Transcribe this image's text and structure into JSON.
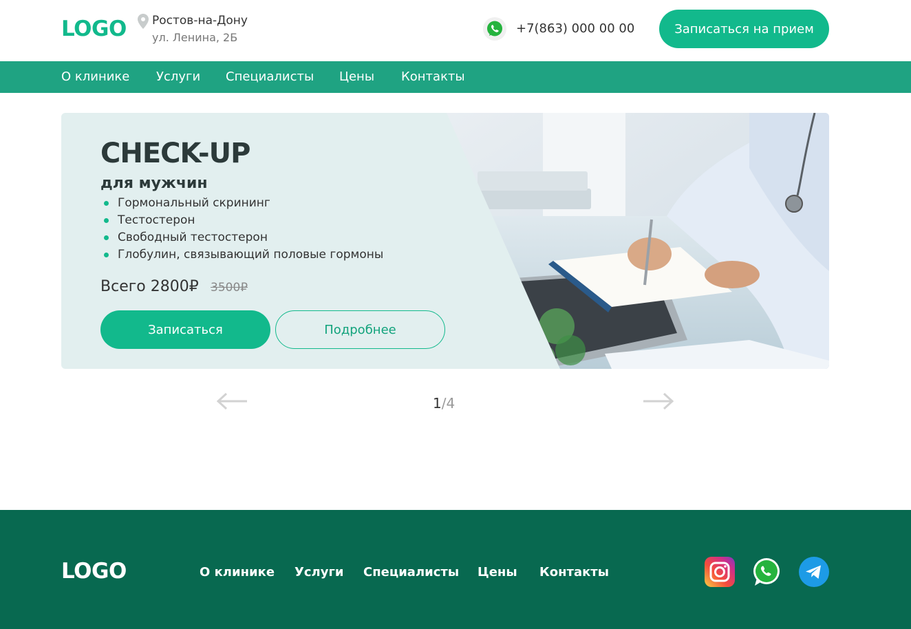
{
  "header": {
    "logo": "LOGO",
    "city": "Ростов-на-Дону",
    "street": "ул. Ленина, 2Б",
    "phone": "+7(863) 000 00 00",
    "cta": "Записаться на прием"
  },
  "nav": [
    "О клинике",
    "Услуги",
    "Специалисты",
    "Цены",
    "Контакты"
  ],
  "banner": {
    "title": "CHECK-UP",
    "subtitle": "для мужчин",
    "items": [
      "Гормональный скрининг",
      "Тестостерон",
      "Свободный тестостерон",
      "Глобулин, связывающий половые гормоны"
    ],
    "price": "Всего 2800₽",
    "old_price": "3500₽",
    "btn_primary": "Записаться",
    "btn_secondary": "Подробнее"
  },
  "slider": {
    "current": "1",
    "total": "/4"
  },
  "footer": {
    "logo": "LOGO",
    "nav": [
      "О клинике",
      "Услуги",
      "Специалисты",
      "Цены",
      "Контакты"
    ],
    "social": [
      "instagram-icon",
      "whatsapp-icon",
      "telegram-icon"
    ]
  },
  "colors": {
    "accent": "#12b98c",
    "nav_bg": "#1fa382",
    "footer_bg": "#086950",
    "banner_bg": "#e2efef"
  }
}
